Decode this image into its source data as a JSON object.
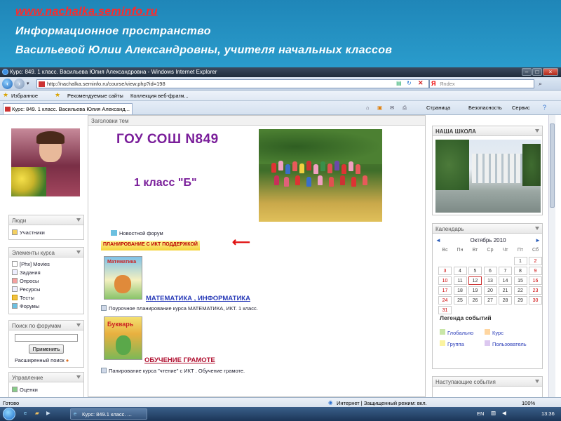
{
  "slide": {
    "site": "www.nachalka.seminfo.ru",
    "line2": "Информационное  пространство",
    "line3": "Васильевой  Юлии  Александровны, учителя  начальных  классов"
  },
  "window": {
    "title": "Курс: 849. 1 класс. Васильева Юлия Александровна - Windows Internet Explorer",
    "url": "http://nachalka.seminfo.ru/course/view.php?id=198",
    "search_placeholder": "Яndex",
    "search_logo": "Я"
  },
  "favorites": {
    "fav_label": "Избранное",
    "item1": "Рекомендуемые сайты",
    "item2": "Коллекция веб-фрагм..."
  },
  "tab": {
    "label": "Курс: 849. 1 класс. Васильева Юлия Александ..."
  },
  "command_bar": {
    "page": "Страница",
    "safety": "Безопасность",
    "tools": "Сервис"
  },
  "left": {
    "people": {
      "title": "Люди",
      "items": [
        "Участники"
      ]
    },
    "course_elements": {
      "title": "Элементы курса",
      "items": [
        "[Phx] Movies",
        "Задания",
        "Опросы",
        "Ресурсы",
        "Тесты",
        "Форумы"
      ]
    },
    "forum_search": {
      "title": "Поиск по форумам",
      "button": "Применить",
      "advanced": "Расширенный поиск"
    },
    "management": {
      "title": "Управление",
      "items": [
        "Оценки"
      ]
    }
  },
  "main": {
    "header": "Заголовки тем",
    "school": "ГОУ СОШ N849",
    "class": "1 класс \"Б\"",
    "news_forum": "Новостной форум",
    "ict_planning": "ПЛАНИРОВАНИЕ С ИКТ ПОДДЕРЖКОЙ",
    "subject1": "МАТЕМАТИКА , ИНФОРМАТИКА",
    "desc1": "Поурочное планирование курса МАТЕМАТИКА, ИКТ. 1 класс.",
    "book1": "Математика",
    "subject2": "ОБУЧЕНИЕ ГРАМОТЕ",
    "desc2": "Панирование курса \"чтение\" с ИКТ . Обучение грамоте.",
    "book2": "Букварь"
  },
  "right": {
    "school_title": "НАША ШКОЛА",
    "calendar": {
      "title": "Календарь",
      "month": "Октябрь 2010",
      "weekdays": [
        "Вс",
        "Пн",
        "Вт",
        "Ср",
        "Чт",
        "Пт",
        "Сб"
      ],
      "weeks": [
        [
          "",
          "",
          "",
          "",
          "",
          "1",
          "2"
        ],
        [
          "3",
          "4",
          "5",
          "6",
          "7",
          "8",
          "9"
        ],
        [
          "10",
          "11",
          "12",
          "13",
          "14",
          "15",
          "16"
        ],
        [
          "17",
          "18",
          "19",
          "20",
          "21",
          "22",
          "23"
        ],
        [
          "24",
          "25",
          "26",
          "27",
          "28",
          "29",
          "30"
        ],
        [
          "31",
          "",
          "",
          "",
          "",
          "",
          ""
        ]
      ],
      "today": "12",
      "legend_title": "Легенда событий",
      "legend": [
        "Глобально",
        "Курс",
        "Группа",
        "Пользователь"
      ]
    },
    "upcoming_title": "Наступающие события"
  },
  "status": {
    "left": "Готово",
    "zone": "Интернет | Защищенный режим: вкл.",
    "zoom": "100%"
  },
  "taskbar": {
    "task": "Курс: 849.1 класс. ...",
    "lang": "EN",
    "time": "13:36"
  }
}
